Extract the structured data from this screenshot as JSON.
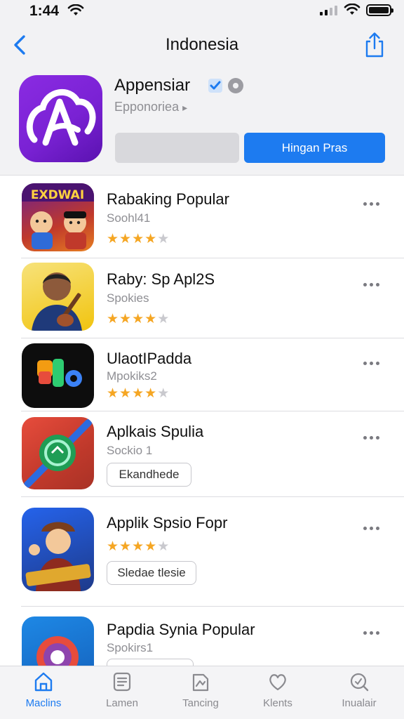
{
  "status_bar": {
    "time": "1:44"
  },
  "header": {
    "title": "Indonesia",
    "app_name": "Appensiar",
    "developer": "Epponoriea",
    "primary_button": "Hingan Pras",
    "secondary_button": ""
  },
  "apps": [
    {
      "title": "Rabaking Popular",
      "subtitle": "Soohl41",
      "rating": 4,
      "pill": ""
    },
    {
      "title": "Raby: Sp Apl2S",
      "subtitle": "Spokies",
      "rating": 4,
      "pill": ""
    },
    {
      "title": "UlaotIPadda",
      "subtitle": "Mpokiks2",
      "rating": 4,
      "pill": ""
    },
    {
      "title": "Aplkais Spulia",
      "subtitle": "Sockio 1",
      "rating": 0,
      "pill": "Ekandhede"
    },
    {
      "title": "Applik Spsio Fopr",
      "subtitle": "",
      "rating": 4,
      "pill": "Sledae tlesie"
    },
    {
      "title": "Papdia Synia Popular",
      "subtitle": "Spokirs1",
      "rating": 0,
      "pill": ""
    }
  ],
  "icon_texts": {
    "game_banner": "EXDWAI"
  },
  "tabs": [
    {
      "label": "Maclins",
      "icon": "home-icon"
    },
    {
      "label": "Lamen",
      "icon": "apps-icon"
    },
    {
      "label": "Tancing",
      "icon": "games-icon"
    },
    {
      "label": "Klents",
      "icon": "heart-icon"
    },
    {
      "label": "Inualair",
      "icon": "search-icon"
    }
  ],
  "colors": {
    "accent": "#1d7bf0",
    "star": "#f5a623",
    "app_icon": "#8a2be2"
  }
}
